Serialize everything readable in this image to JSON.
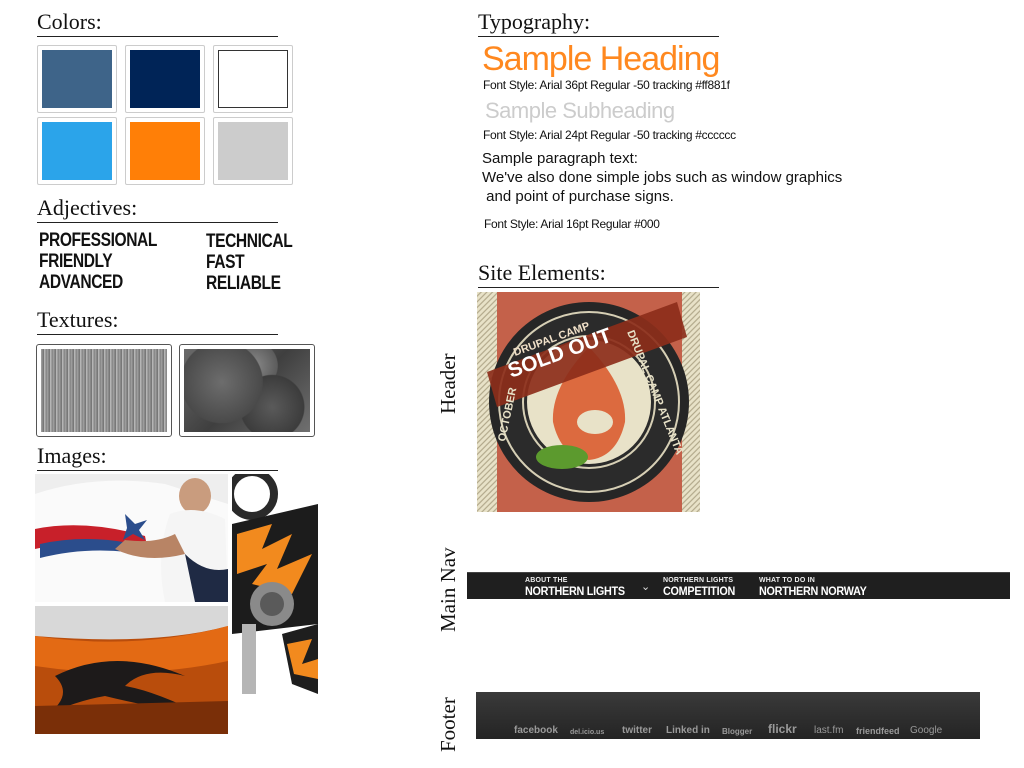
{
  "colors": {
    "title": "Colors:",
    "swatches": [
      "#3e6489",
      "#002457",
      "#ffffff",
      "#2ba4ea",
      "#ff7f07",
      "#cccccc"
    ]
  },
  "adjectives": {
    "title": "Adjectives:",
    "left": [
      "PROFESSIONAL",
      "FRIENDLY",
      "ADVANCED"
    ],
    "right": [
      "TECHNICAL",
      "FAST",
      "RELIABLE"
    ]
  },
  "textures": {
    "title": "Textures:",
    "items": [
      "wood-grain-lines-texture",
      "stone-texture"
    ]
  },
  "images": {
    "title": "Images:",
    "items": [
      "vehicle-graphics-install-photo",
      "motocross-bike-photo",
      "orange-car-tribal-decal-photo"
    ]
  },
  "typography": {
    "title": "Typography:",
    "heading_sample": "Sample Heading",
    "heading_note": "Font Style: Arial 36pt Regular -50 tracking #ff881f",
    "subheading_sample": "Sample Subheading",
    "subheading_note": "Font Style: Arial 24pt Regular -50 tracking #cccccc",
    "paragraph_label": "Sample paragraph text:",
    "paragraph_line1": "We've also done simple jobs such as window graphics",
    "paragraph_line2": " and point of purchase signs.",
    "paragraph_note": "Font Style: Arial 16pt Regular #000"
  },
  "site_elements": {
    "title": "Site Elements:",
    "labels": {
      "header": "Header",
      "main_nav": "Main Nav",
      "footer": "Footer"
    },
    "badge": {
      "sold_out_top": "DRUPAL CAMP",
      "sold_out": "SOLD OUT",
      "ring_left": "OCTOBER",
      "ring_right": "DRUPAL CAMP ATLANTA"
    },
    "nav": [
      {
        "small": "ABOUT THE",
        "big": "NORTHERN LIGHTS",
        "caret": "⌄"
      },
      {
        "small": "NORTHERN LIGHTS",
        "big": "COMPETITION",
        "caret": ""
      },
      {
        "small": "WHAT TO DO IN",
        "big": "NORTHERN NORWAY",
        "caret": ""
      }
    ],
    "footer_links": [
      "facebook",
      "del.icio.us",
      "twitter",
      "Linked in",
      "Blogger",
      "flickr",
      "last.fm",
      "friendfeed",
      "Google"
    ]
  }
}
